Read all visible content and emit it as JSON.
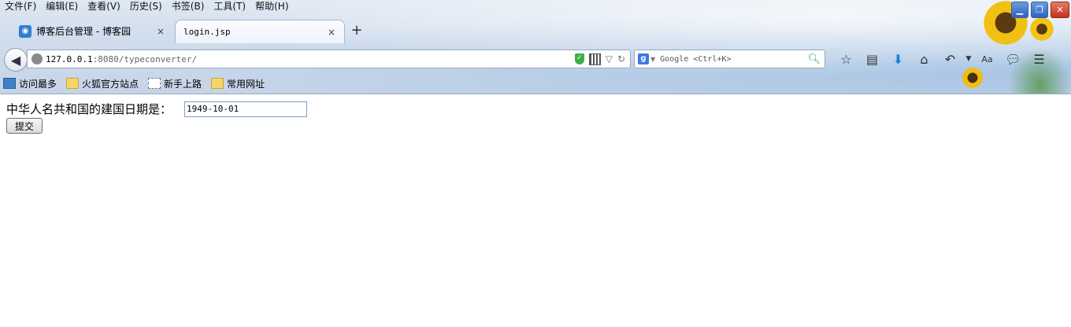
{
  "menu": [
    "文件(F)",
    "编辑(E)",
    "查看(V)",
    "历史(S)",
    "书签(B)",
    "工具(T)",
    "帮助(H)"
  ],
  "tabs": [
    {
      "title": "博客后台管理 - 博客园",
      "close": "×"
    },
    {
      "title": "login.jsp",
      "close": "×"
    }
  ],
  "newtab": "+",
  "url": {
    "host": "127.0.0.1",
    "rest": ":8080/typeconverter/"
  },
  "search": {
    "placeholder": "Google <Ctrl+K>"
  },
  "bookmarks": [
    "访问最多",
    "火狐官方站点",
    "新手上路",
    "常用网址"
  ],
  "form": {
    "label": "中华人名共和国的建国日期是：",
    "date_value": "1949-10-01",
    "submit": "提交"
  },
  "icons": {
    "back": "back-arrow-icon",
    "star": "star-icon",
    "reader": "reader-icon",
    "download": "download-icon",
    "home": "home-icon",
    "undo": "undo-icon",
    "translate": "translate-icon",
    "chat": "chat-icon",
    "menu": "hamburger-icon"
  },
  "colors": {
    "download_icon": "#1c7fd6",
    "shield": "#3fae49"
  }
}
